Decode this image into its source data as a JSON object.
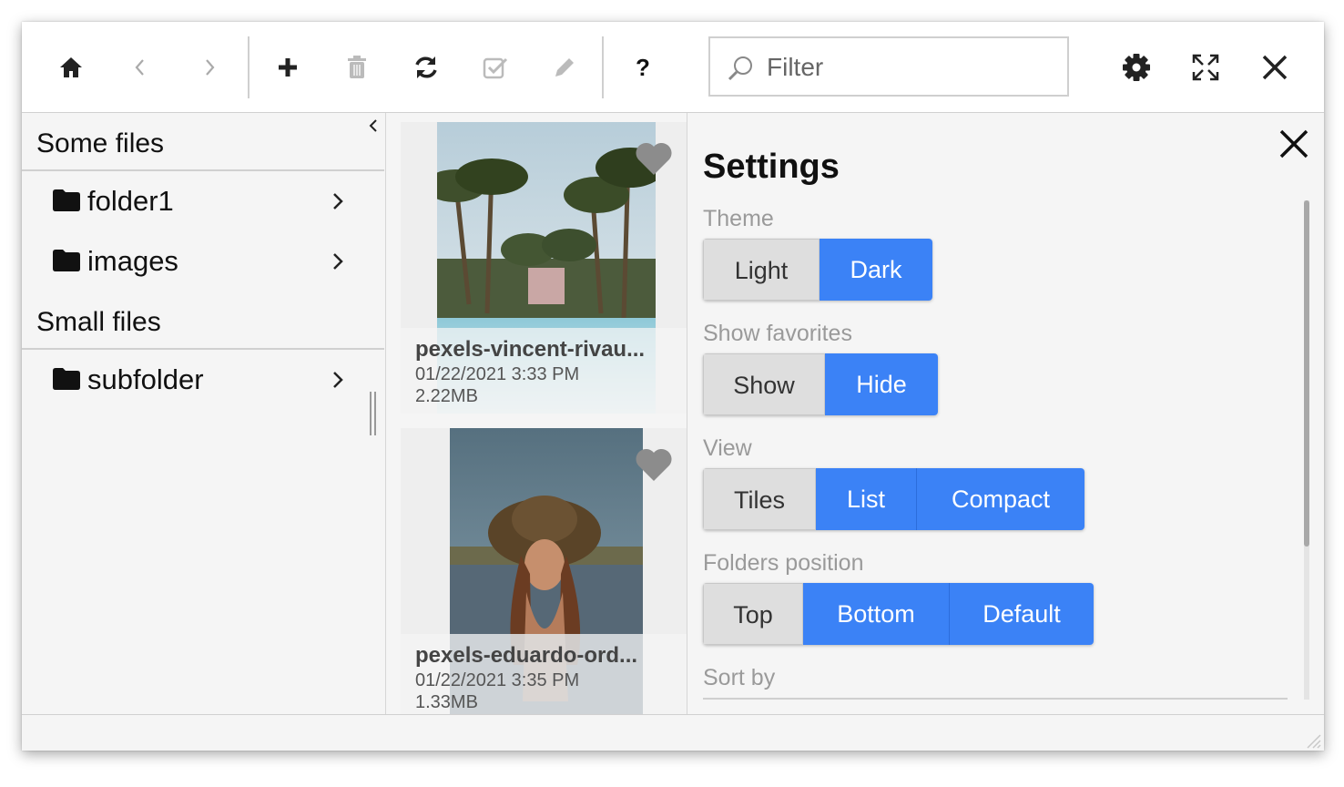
{
  "toolbar": {
    "icons": [
      "home-icon",
      "back-icon",
      "forward-icon",
      "plus-icon",
      "trash-icon",
      "refresh-icon",
      "check-square-icon",
      "pencil-icon",
      "help-icon",
      "gear-icon",
      "expand-icon",
      "close-icon"
    ],
    "help_label": "?",
    "filter_placeholder": "Filter"
  },
  "sidebar": {
    "groups": [
      {
        "heading": "Some files",
        "items": [
          "folder1",
          "images"
        ]
      },
      {
        "heading": "Small files",
        "items": [
          "subfolder"
        ]
      }
    ]
  },
  "files": [
    {
      "name": "pexels-vincent-rivau...",
      "date": "01/22/2021 3:33 PM",
      "size": "2.22MB",
      "favorite": true
    },
    {
      "name": "pexels-eduardo-ord...",
      "date": "01/22/2021 3:35 PM",
      "size": "1.33MB",
      "favorite": true
    }
  ],
  "settings": {
    "title": "Settings",
    "theme": {
      "label": "Theme",
      "options": [
        "Light",
        "Dark"
      ],
      "selected": [
        "Dark"
      ]
    },
    "favorites": {
      "label": "Show favorites",
      "options": [
        "Show",
        "Hide"
      ],
      "selected": [
        "Hide"
      ]
    },
    "view": {
      "label": "View",
      "options": [
        "Tiles",
        "List",
        "Compact"
      ],
      "selected": [
        "List",
        "Compact"
      ]
    },
    "folders_position": {
      "label": "Folders position",
      "options": [
        "Top",
        "Bottom",
        "Default"
      ],
      "selected": [
        "Bottom",
        "Default"
      ]
    },
    "sort_by": {
      "label": "Sort by"
    }
  },
  "colors": {
    "accent": "#3b82f6",
    "panel": "#f5f5f5",
    "button_off": "#dedede"
  }
}
